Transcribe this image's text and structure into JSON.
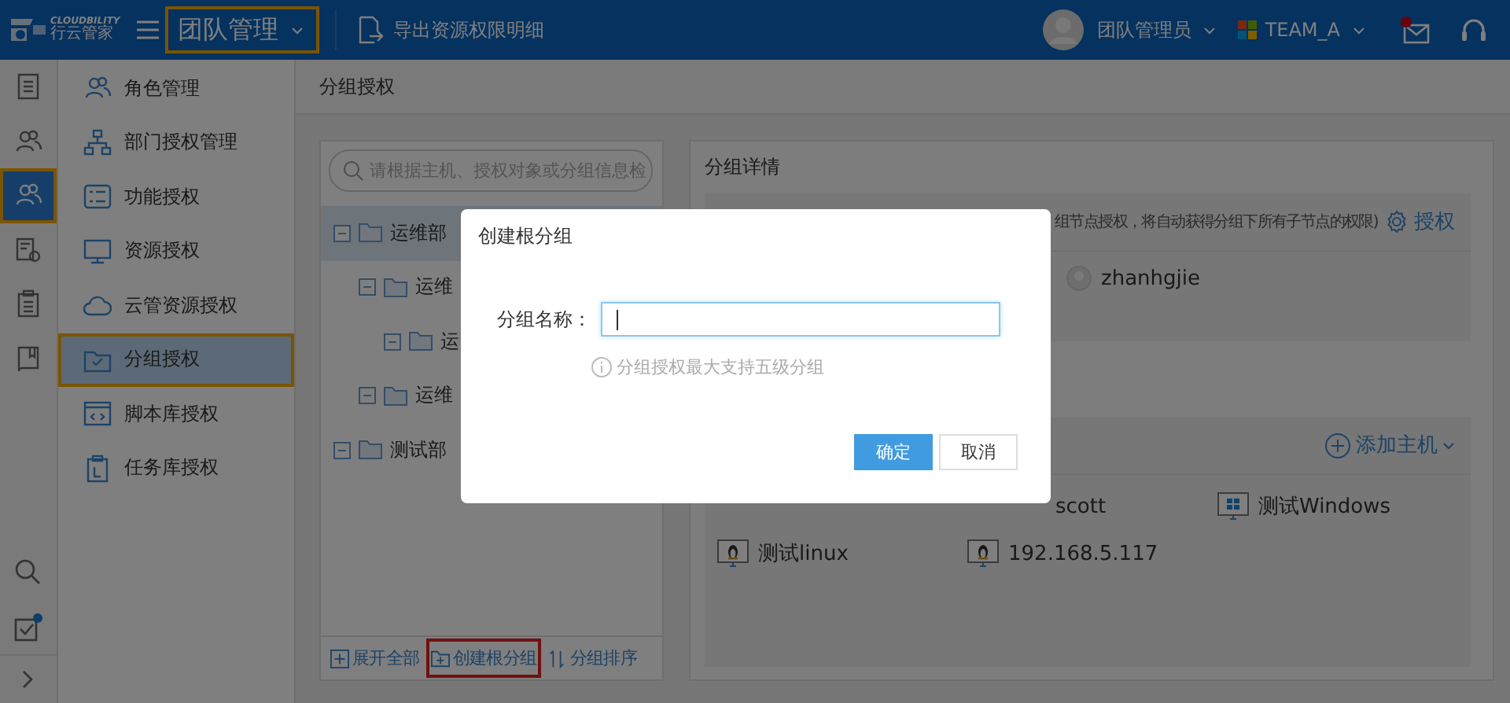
{
  "header": {
    "logo": {
      "name": "CLOUDBILITY",
      "sub": "行云管家"
    },
    "module": {
      "title": "团队管理",
      "highlighted": true
    },
    "export": "导出资源权限明细",
    "user": "团队管理员",
    "team": "TEAM_A",
    "mail_unread": true
  },
  "rail": {
    "items": [
      {
        "kind": "doc",
        "selected": false,
        "highlighted": false
      },
      {
        "kind": "users",
        "selected": false,
        "highlighted": false
      },
      {
        "kind": "users",
        "selected": true,
        "highlighted": true
      },
      {
        "kind": "monitor-gear",
        "selected": false,
        "highlighted": false
      },
      {
        "kind": "clipboard",
        "selected": false,
        "highlighted": false
      },
      {
        "kind": "book",
        "selected": false,
        "highlighted": false
      }
    ],
    "bottom": [
      {
        "kind": "search",
        "badge": false
      },
      {
        "kind": "tasks",
        "badge": true
      }
    ]
  },
  "menu": [
    {
      "label": "角色管理",
      "kind": "users",
      "selected": false,
      "highlighted": false
    },
    {
      "label": "部门授权管理",
      "kind": "org",
      "selected": false,
      "highlighted": false
    },
    {
      "label": "功能授权",
      "kind": "list",
      "selected": false,
      "highlighted": false
    },
    {
      "label": "资源授权",
      "kind": "monitor",
      "selected": false,
      "highlighted": false
    },
    {
      "label": "云管资源授权",
      "kind": "cloud",
      "selected": false,
      "highlighted": false
    },
    {
      "label": "分组授权",
      "kind": "folder",
      "selected": true,
      "highlighted": true
    },
    {
      "label": "脚本库授权",
      "kind": "code",
      "selected": false,
      "highlighted": false
    },
    {
      "label": "任务库授权",
      "kind": "task",
      "selected": false,
      "highlighted": false
    }
  ],
  "breadcrumb": "分组授权",
  "tree": {
    "search": {
      "placeholder": "请根据主机、授权对象或分组信息检"
    },
    "nodes": [
      {
        "label": "运维部",
        "selected": true,
        "expanded": true,
        "children": [
          {
            "label": "运维",
            "selected": false,
            "expanded": true,
            "children": [
              {
                "label": "运",
                "selected": false,
                "expanded": true
              }
            ]
          },
          {
            "label": "运维",
            "selected": false,
            "expanded": true
          }
        ]
      },
      {
        "label": "测试部",
        "selected": false,
        "expanded": true
      }
    ],
    "footer": [
      {
        "label": "展开全部",
        "kind": "expand",
        "highlighted": false
      },
      {
        "label": "创建根分组",
        "kind": "folder-plus",
        "highlighted": true
      },
      {
        "label": "分组排序",
        "kind": "sort",
        "highlighted": false
      }
    ]
  },
  "detail": {
    "title": "分组详情",
    "auth": {
      "hint": "组节点授权，将自动获得分组下所有子节点的权限)",
      "action": "授权",
      "users": [
        "zhanhgjie"
      ]
    },
    "hosts": {
      "action": "添加主机",
      "items": [
        {
          "name": "scott",
          "kind": "covered"
        },
        {
          "name": "测试Windows",
          "kind": "windows"
        },
        {
          "name": "测试linux",
          "kind": "linux"
        },
        {
          "name": "192.168.5.117",
          "kind": "linux"
        }
      ]
    }
  },
  "dialog": {
    "title": "创建根分组",
    "field": {
      "label": "分组名称：",
      "focused": true
    },
    "hint": "分组授权最大支持五级分组",
    "buttons": [
      {
        "label": "确定",
        "primary": true
      },
      {
        "label": "取消",
        "primary": false
      }
    ]
  }
}
